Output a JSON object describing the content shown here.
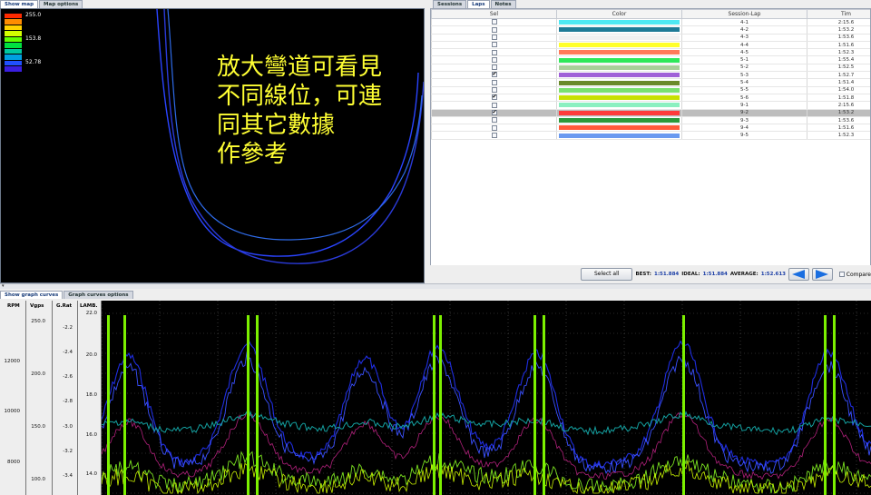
{
  "map_tabs": [
    "Show map",
    "Map options"
  ],
  "laps_tabs": [
    "Sessions",
    "Laps",
    "Notes"
  ],
  "graph_tabs": [
    "Show graph curves",
    "Graph curves options"
  ],
  "legend": {
    "labels": [
      "255.0",
      "153.8",
      "52.78"
    ],
    "colors": [
      "#ff2a00",
      "#ff8c00",
      "#ffd200",
      "#d4ff00",
      "#62ff00",
      "#00e040",
      "#00c8a0",
      "#00a0e0",
      "#2050ff",
      "#3a1ee0"
    ]
  },
  "caption": [
    "放大彎道可看見",
    "不同線位，可連",
    "同其它數據",
    "作參考"
  ],
  "laps_table": {
    "headers": [
      "Sel",
      "Color",
      "Session-Lap",
      "Tim"
    ],
    "rows": [
      {
        "sel": false,
        "color": "#4ee8f2",
        "lap": "4-1",
        "time": "2:15.6",
        "selected": false
      },
      {
        "sel": false,
        "color": "#1e7a96",
        "lap": "4-2",
        "time": "1:53.2",
        "selected": false
      },
      {
        "sel": false,
        "color": "#f0f0f0",
        "lap": "4-3",
        "time": "1:53.6",
        "selected": false
      },
      {
        "sel": false,
        "color": "#ffff2a",
        "lap": "4-4",
        "time": "1:51.6",
        "selected": false
      },
      {
        "sel": false,
        "color": "#ff7a5a",
        "lap": "4-5",
        "time": "1:52.3",
        "selected": false
      },
      {
        "sel": false,
        "color": "#2ee85a",
        "lap": "5-1",
        "time": "1:55.4",
        "selected": false
      },
      {
        "sel": false,
        "color": "#a8cf9a",
        "lap": "5-2",
        "time": "1:52.5",
        "selected": false
      },
      {
        "sel": true,
        "color": "#a060d8",
        "lap": "5-3",
        "time": "1:52.7",
        "selected": false
      },
      {
        "sel": false,
        "color": "#6a8a2a",
        "lap": "5-4",
        "time": "1:51.4",
        "selected": false
      },
      {
        "sel": false,
        "color": "#7ae070",
        "lap": "5-5",
        "time": "1:54.0",
        "selected": false
      },
      {
        "sel": true,
        "color": "#c8e000",
        "lap": "5-6",
        "time": "1:51.8",
        "selected": false
      },
      {
        "sel": false,
        "color": "#8af0c0",
        "lap": "9-1",
        "time": "2:15.6",
        "selected": false
      },
      {
        "sel": true,
        "color": "#ff3a3a",
        "lap": "9-2",
        "time": "1:53.2",
        "selected": true
      },
      {
        "sel": false,
        "color": "#2a9a3a",
        "lap": "9-3",
        "time": "1:53.6",
        "selected": false
      },
      {
        "sel": false,
        "color": "#ff5a3a",
        "lap": "9-4",
        "time": "1:51.6",
        "selected": false
      },
      {
        "sel": false,
        "color": "#6a9af0",
        "lap": "9-5",
        "time": "1:52.3",
        "selected": false
      }
    ]
  },
  "toolbar": {
    "select_all": "Select all",
    "best_label": "BEST:",
    "best_value": "1:51.884",
    "ideal_label": "IDEAL:",
    "ideal_value": "1:51.884",
    "average_label": "AVERAGE:",
    "average_value": "1:52.613",
    "compare_label": "Compare"
  },
  "graph_axes": [
    {
      "title": "RPM",
      "ticks": [
        "12000",
        "10000",
        "8000"
      ]
    },
    {
      "title": "Vgps",
      "ticks": [
        "250.0",
        "200.0",
        "150.0",
        "100.0"
      ]
    },
    {
      "title": "G.Rat",
      "ticks": [
        "-2.2",
        "-2.4",
        "-2.6",
        "-2.8",
        "-3.0",
        "-3.2",
        "-3.4"
      ]
    },
    {
      "title": "LAMB.",
      "ticks": [
        "22.0",
        "20.0",
        "18.0",
        "16.0",
        "14.0"
      ]
    }
  ],
  "colors": {
    "selection_blue": "#1c3fa6",
    "arrow_blue": "#1a6ee0",
    "caption_yellow": "#ffff33"
  }
}
